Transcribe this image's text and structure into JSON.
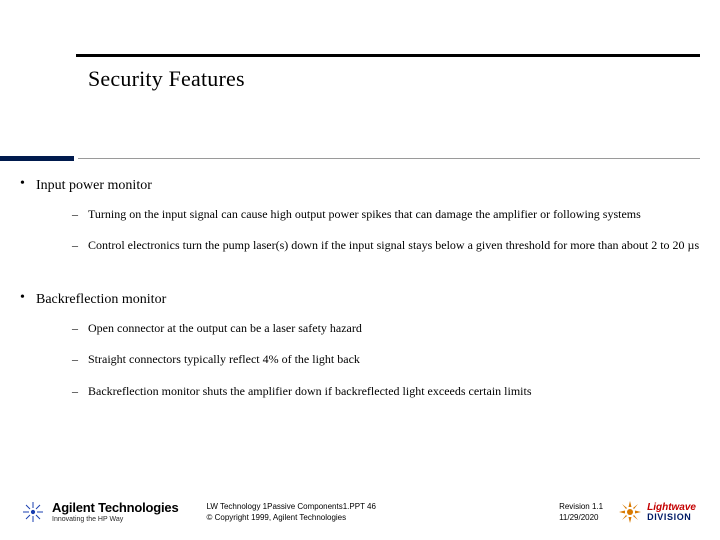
{
  "title": "Security Features",
  "bullets": [
    {
      "label": "Input power monitor",
      "sub": [
        "Turning on the input signal can cause high output power spikes that can damage the amplifier or following systems",
        "Control electronics turn the pump laser(s) down if the input signal stays below a given threshold for more than about 2 to 20 µs"
      ]
    },
    {
      "label": "Backreflection monitor",
      "sub": [
        "Open connector at the output can be a laser safety hazard",
        "Straight connectors typically reflect 4% of the light back",
        "Backreflection monitor shuts the amplifier down if backreflected light exceeds certain limits"
      ]
    }
  ],
  "footer": {
    "agilent": {
      "name": "Agilent Technologies",
      "tagline": "Innovating the HP Way"
    },
    "center_line1": "LW Technology 1Passive Components1.PPT   46",
    "center_line2": "© Copyright 1999, Agilent Technologies",
    "revision": "Revision 1.1",
    "date": "11/29/2020",
    "lightwave": {
      "top": "Lightwave",
      "bottom": "DIVISION"
    }
  }
}
